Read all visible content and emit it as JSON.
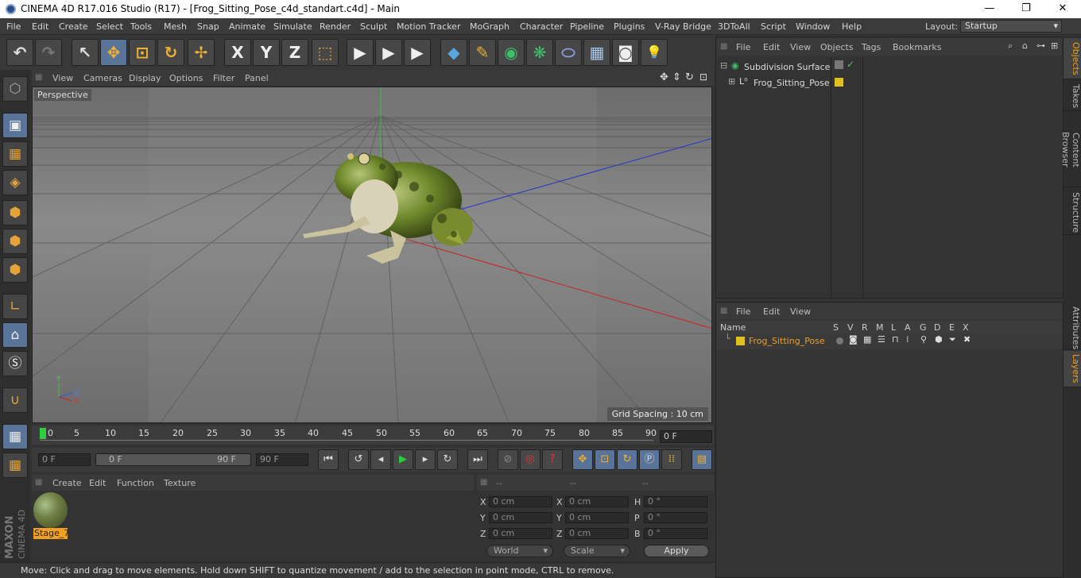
{
  "window": {
    "title": "CINEMA 4D R17.016 Studio (R17) - [Frog_Sitting_Pose_c4d_standart.c4d] - Main",
    "min": "—",
    "max": "❐",
    "close": "✕"
  },
  "menu": [
    "File",
    "Edit",
    "Create",
    "Select",
    "Tools",
    "Mesh",
    "Snap",
    "Animate",
    "Simulate",
    "Render",
    "Sculpt",
    "Motion Tracker",
    "MoGraph",
    "Character",
    "Pipeline",
    "Plugins",
    "V-Ray Bridge",
    "3DToAll",
    "Script",
    "Window",
    "Help"
  ],
  "layout": {
    "label": "Layout:",
    "value": "Startup"
  },
  "toolbar": {
    "undo": "↶",
    "redo": "↷",
    "select": "↖",
    "move": "✥",
    "scale": "⊡",
    "rotate": "↻",
    "transform": "✢",
    "axis_x": "X",
    "axis_y": "Y",
    "axis_z": "Z",
    "coord": "⬚",
    "render_view": "▶",
    "render_pv": "▶",
    "render_settings": "▶",
    "cube": "◆",
    "pen": "✎",
    "generator": "◉",
    "cloner": "❋",
    "deformer": "⬭",
    "floor": "▦",
    "camera": "◙",
    "light": "💡"
  },
  "viewport": {
    "menu": [
      "View",
      "Cameras",
      "Display",
      "Options",
      "Filter",
      "Panel"
    ],
    "camera_label": "Perspective",
    "grid_spacing": "Grid Spacing : 10 cm",
    "axis_y": "Y",
    "axis_z": "Z",
    "axis_x": "X"
  },
  "timeline": {
    "ticks": [
      "0",
      "5",
      "10",
      "15",
      "20",
      "25",
      "30",
      "35",
      "40",
      "45",
      "50",
      "55",
      "60",
      "65",
      "70",
      "75",
      "80",
      "85",
      "90"
    ],
    "current_frame": "0 F"
  },
  "transport": {
    "start": "0 F",
    "range_min": "0 F",
    "range_max": "90 F",
    "end": "90 F"
  },
  "material": {
    "menu": [
      "Create",
      "Edit",
      "Function",
      "Texture"
    ],
    "name": "Stage_7"
  },
  "coords": {
    "headers": [
      "--",
      "--",
      "--"
    ],
    "rows": [
      {
        "a": "X",
        "av": "0 cm",
        "b": "X",
        "bv": "0 cm",
        "c": "H",
        "cv": "0 °"
      },
      {
        "a": "Y",
        "av": "0 cm",
        "b": "Y",
        "bv": "0 cm",
        "c": "P",
        "cv": "0 °"
      },
      {
        "a": "Z",
        "av": "0 cm",
        "b": "Z",
        "bv": "0 cm",
        "c": "B",
        "cv": "0 °"
      }
    ],
    "space": "World",
    "mode": "Scale",
    "apply": "Apply"
  },
  "status": "Move: Click and drag to move elements. Hold down SHIFT to quantize movement / add to the selection in point mode, CTRL to remove.",
  "brand": {
    "maxon": "MAXON",
    "product": "CINEMA 4D"
  },
  "objects": {
    "menu": [
      "File",
      "Edit",
      "View",
      "Objects",
      "Tags",
      "Bookmarks"
    ],
    "items": [
      {
        "name": "Subdivision Surface",
        "indent": 0
      },
      {
        "name": "Frog_Sitting_Pose",
        "indent": 1
      }
    ]
  },
  "layers": {
    "menu": [
      "File",
      "Edit",
      "View"
    ],
    "columns": [
      "Name",
      "S",
      "V",
      "R",
      "M",
      "L",
      "A",
      "G",
      "D",
      "E",
      "X"
    ],
    "items": [
      {
        "name": "Frog_Sitting_Pose",
        "color": "#e0c020"
      }
    ]
  },
  "side_tabs": [
    "Objects",
    "Takes",
    "Content Browser",
    "Structure",
    "Attributes",
    "Layers"
  ],
  "colors": {
    "accent": "#5a7398",
    "highlight": "#f0a020",
    "layer": "#e0c020",
    "bg": "#333333"
  }
}
